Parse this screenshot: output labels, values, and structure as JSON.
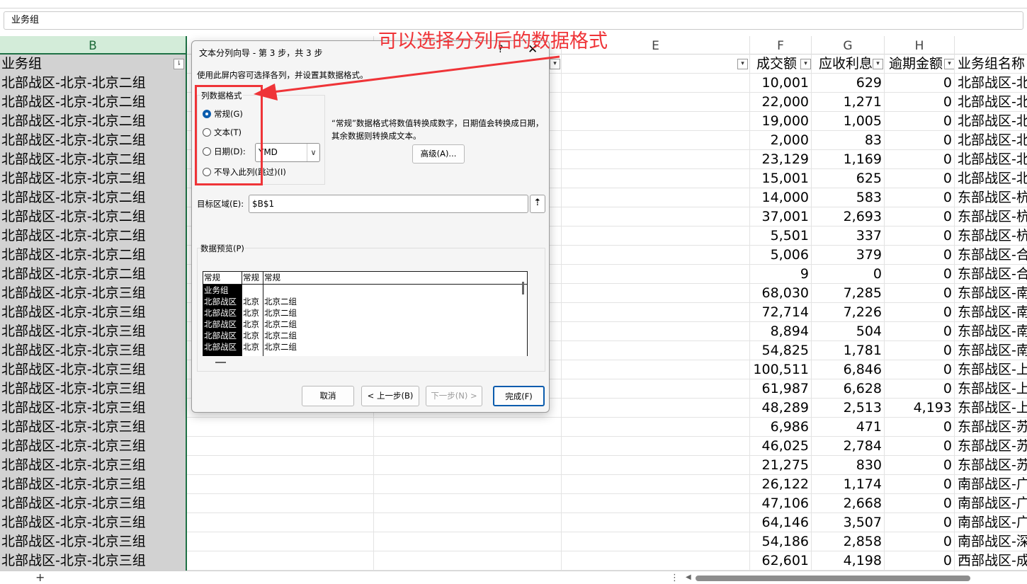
{
  "formula_bar": {
    "value": "业务组"
  },
  "columns": {
    "B": "B",
    "E": "E",
    "F": "F",
    "G": "G",
    "H": "H"
  },
  "header_row": {
    "B": "业务组",
    "F": "成交额",
    "G": "应收利息",
    "H": "逾期金额",
    "I": "业务组名称"
  },
  "rows": [
    {
      "B": "北部战区-北京-北京二组",
      "F": "10,001",
      "G": "629",
      "H": "0",
      "I": "北部战区-北"
    },
    {
      "B": "北部战区-北京-北京二组",
      "F": "22,000",
      "G": "1,271",
      "H": "0",
      "I": "北部战区-北"
    },
    {
      "B": "北部战区-北京-北京二组",
      "F": "19,000",
      "G": "1,005",
      "H": "0",
      "I": "北部战区-北"
    },
    {
      "B": "北部战区-北京-北京二组",
      "F": "2,000",
      "G": "83",
      "H": "0",
      "I": "北部战区-北"
    },
    {
      "B": "北部战区-北京-北京二组",
      "F": "23,129",
      "G": "1,169",
      "H": "0",
      "I": "北部战区-北"
    },
    {
      "B": "北部战区-北京-北京二组",
      "F": "15,001",
      "G": "625",
      "H": "0",
      "I": "北部战区-北"
    },
    {
      "B": "北部战区-北京-北京二组",
      "F": "14,000",
      "G": "583",
      "H": "0",
      "I": "东部战区-杭"
    },
    {
      "B": "北部战区-北京-北京二组",
      "F": "37,001",
      "G": "2,693",
      "H": "0",
      "I": "东部战区-杭"
    },
    {
      "B": "北部战区-北京-北京二组",
      "F": "5,501",
      "G": "337",
      "H": "0",
      "I": "东部战区-杭"
    },
    {
      "B": "北部战区-北京-北京二组",
      "F": "5,006",
      "G": "379",
      "H": "0",
      "I": "东部战区-合"
    },
    {
      "B": "北部战区-北京-北京二组",
      "F": "9",
      "G": "0",
      "H": "0",
      "I": "东部战区-合"
    },
    {
      "B": "北部战区-北京-北京三组",
      "F": "68,030",
      "G": "7,285",
      "H": "0",
      "I": "东部战区-南"
    },
    {
      "B": "北部战区-北京-北京三组",
      "F": "72,714",
      "G": "7,226",
      "H": "0",
      "I": "东部战区-南"
    },
    {
      "B": "北部战区-北京-北京三组",
      "F": "8,894",
      "G": "504",
      "H": "0",
      "I": "东部战区-南"
    },
    {
      "B": "北部战区-北京-北京三组",
      "F": "54,825",
      "G": "1,781",
      "H": "0",
      "I": "东部战区-南"
    },
    {
      "B": "北部战区-北京-北京三组",
      "F": "100,511",
      "G": "6,846",
      "H": "0",
      "I": "东部战区-上"
    },
    {
      "B": "北部战区-北京-北京三组",
      "F": "61,987",
      "G": "6,628",
      "H": "0",
      "I": "东部战区-上"
    },
    {
      "B": "北部战区-北京-北京三组",
      "F": "48,289",
      "G": "2,513",
      "H": "4,193",
      "I": "东部战区-上"
    },
    {
      "B": "北部战区-北京-北京三组",
      "F": "6,986",
      "G": "471",
      "H": "0",
      "I": "东部战区-苏"
    },
    {
      "B": "北部战区-北京-北京三组",
      "F": "46,025",
      "G": "2,784",
      "H": "0",
      "I": "东部战区-苏"
    },
    {
      "B": "北部战区-北京-北京三组",
      "F": "21,275",
      "G": "830",
      "H": "0",
      "I": "东部战区-苏"
    },
    {
      "B": "北部战区-北京-北京三组",
      "F": "26,122",
      "G": "1,174",
      "H": "0",
      "I": "南部战区-广"
    },
    {
      "B": "北部战区-北京-北京三组",
      "F": "47,106",
      "G": "2,668",
      "H": "0",
      "I": "南部战区-广"
    },
    {
      "B": "北部战区-北京-北京三组",
      "F": "64,146",
      "G": "3,507",
      "H": "0",
      "I": "南部战区-广"
    },
    {
      "B": "北部战区-北京-北京三组",
      "F": "54,186",
      "G": "2,858",
      "H": "0",
      "I": "南部战区-深"
    },
    {
      "B": "北部战区-北京-北京三组",
      "F": "62,601",
      "G": "4,198",
      "H": "0",
      "I": "西部战区-成"
    }
  ],
  "sheet_bar": {
    "add_label": "+",
    "more": "⋮",
    "scroll_left": "◀"
  },
  "dialog": {
    "title": "文本分列向导 - 第 3 步，共 3 步",
    "help": "?",
    "close": "✕",
    "instructions": "使用此屏内容可选择各列，并设置其数据格式。",
    "format_group_label": "列数据格式",
    "options": {
      "general": "常规(G)",
      "text": "文本(T)",
      "date": "日期(D):",
      "skip": "不导入此列(跳过)(I)"
    },
    "date_format_value": "YMD",
    "description": "“常规”数据格式将数值转换成数字，日期值会转换成日期，其余数据则转换成文本。",
    "advanced_label": "高级(A)...",
    "destination_label": "目标区域(E):",
    "destination_value": "$B$1",
    "collapse_icon": "⇡",
    "preview_label": "数据预览(P)",
    "preview": {
      "headers": [
        "常规",
        "常规",
        "常规"
      ],
      "col1": [
        "业务组",
        "北部战区",
        "北部战区",
        "北部战区",
        "北部战区",
        "北部战区"
      ],
      "col2": [
        "北京",
        "北京",
        "北京",
        "北京",
        "北京"
      ],
      "col3": [
        "北京二组",
        "北京二组",
        "北京二组",
        "北京二组",
        "北京二组"
      ]
    },
    "buttons": {
      "cancel": "取消",
      "back": "< 上一步(B)",
      "next": "下一步(N) >",
      "finish": "完成(F)"
    }
  },
  "annotation": {
    "text": "可以选择分列后的数据格式",
    "color": "#ef3438"
  },
  "colors": {
    "accent": "#0b5cad",
    "excel_green": "#1e7145"
  }
}
